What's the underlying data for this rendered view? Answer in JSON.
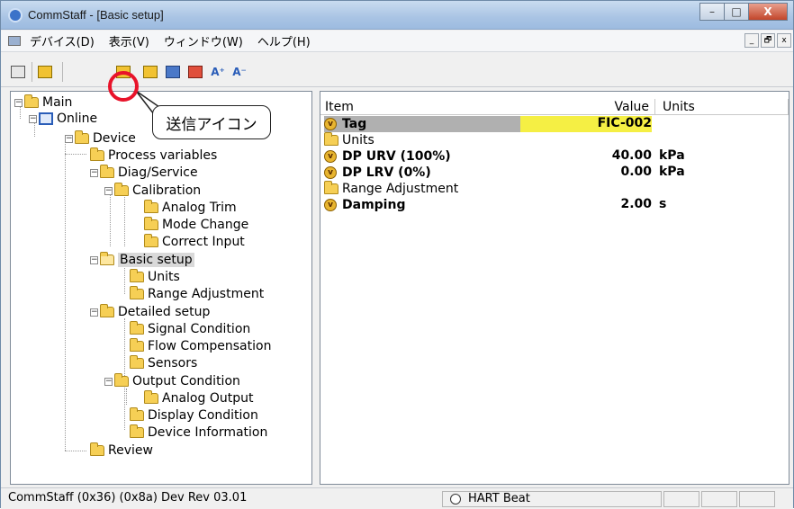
{
  "window": {
    "title": "CommStaff - [Basic setup]",
    "controls": [
      "–",
      "□",
      "X"
    ]
  },
  "menu": {
    "items": [
      "デバイス(D)",
      "表示(V)",
      "ウィンドウ(W)",
      "ヘルプ(H)"
    ],
    "mdi_controls": [
      "_",
      "🗗",
      "x"
    ]
  },
  "toolbar": {
    "icons": [
      "new-doc-icon",
      "hart-device-icon",
      "send-icon",
      "config-icon",
      "refresh-icon",
      "device-status-icon",
      "font-increase-icon",
      "font-decrease-icon"
    ],
    "font_up": "A⁺",
    "font_down": "A⁻"
  },
  "callout": {
    "label": "送信アイコン"
  },
  "tree": {
    "main": "Main",
    "online": "Online",
    "device": "Device",
    "process_variables": "Process variables",
    "diag_service": "Diag/Service",
    "calibration": "Calibration",
    "analog_trim": "Analog Trim",
    "mode_change": "Mode Change",
    "correct_input": "Correct Input",
    "basic_setup": "Basic setup",
    "units": "Units",
    "range_adjustment": "Range Adjustment",
    "detailed_setup": "Detailed setup",
    "signal_condition": "Signal Condition",
    "flow_compensation": "Flow Compensation",
    "sensors": "Sensors",
    "output_condition": "Output Condition",
    "analog_output": "Analog Output",
    "display_condition": "Display Condition",
    "device_information": "Device Information",
    "review": "Review"
  },
  "list": {
    "headers": {
      "item": "Item",
      "value": "Value",
      "units": "Units"
    },
    "rows": [
      {
        "item": "Tag",
        "value": "FIC-002",
        "units": ""
      },
      {
        "item": "Units",
        "value": "",
        "units": ""
      },
      {
        "item": "DP URV (100%)",
        "value": "40.00",
        "units": "kPa"
      },
      {
        "item": "DP LRV (0%)",
        "value": "0.00",
        "units": "kPa"
      },
      {
        "item": "Range Adjustment",
        "value": "",
        "units": ""
      },
      {
        "item": "Damping",
        "value": "2.00",
        "units": "s"
      }
    ]
  },
  "status": {
    "left": "CommStaff  (0x36)  (0x8a) Dev Rev 03.01",
    "hart": "HART Beat"
  },
  "colors": {
    "highlight_circle": "#e8132a",
    "tag_value_bg": "#f5ef44",
    "tag_item_bg": "#b0b0b0"
  }
}
